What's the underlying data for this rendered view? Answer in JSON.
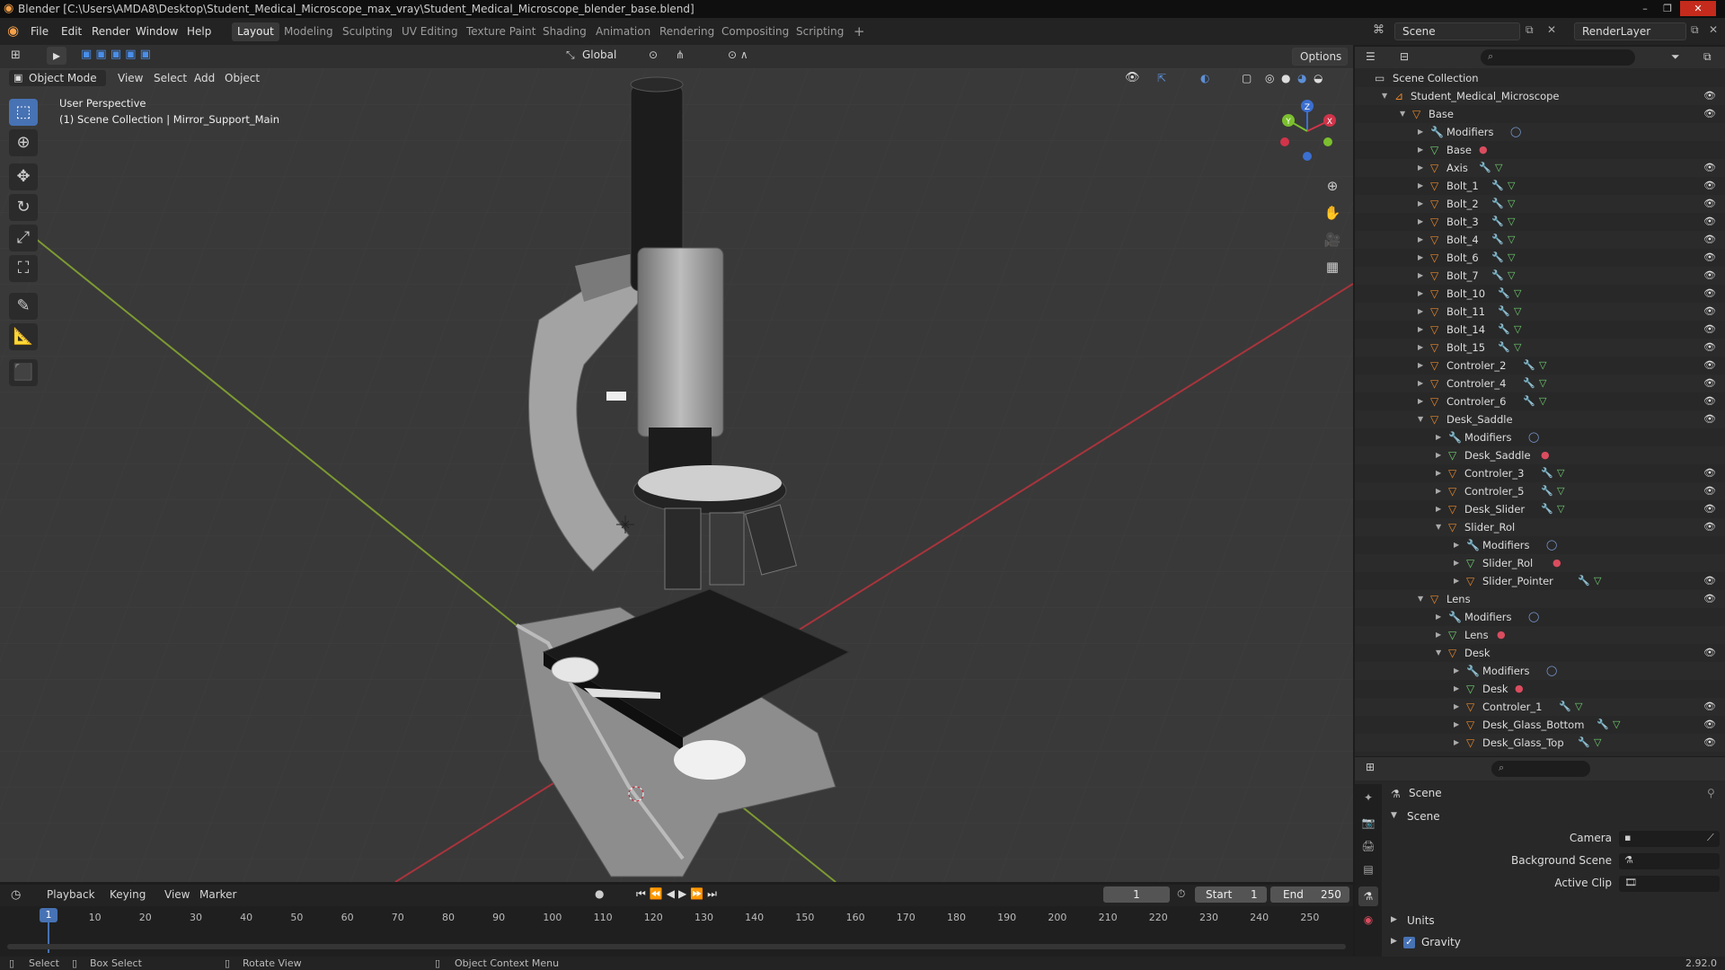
{
  "window": {
    "title": "Blender [C:\\Users\\AMDA8\\Desktop\\Student_Medical_Microscope_max_vray\\Student_Medical_Microscope_blender_base.blend]"
  },
  "menu": [
    "File",
    "Edit",
    "Render",
    "Window",
    "Help"
  ],
  "workspaces": [
    "Layout",
    "Modeling",
    "Sculpting",
    "UV Editing",
    "Texture Paint",
    "Shading",
    "Animation",
    "Rendering",
    "Compositing",
    "Scripting"
  ],
  "active_workspace": "Layout",
  "scene": {
    "name": "Scene",
    "render_layer": "RenderLayer"
  },
  "viewport": {
    "mode": "Object Mode",
    "menus": [
      "View",
      "Select",
      "Add",
      "Object"
    ],
    "transform_orientation": "Global",
    "options_label": "Options",
    "overlay_line1": "User Perspective",
    "overlay_line2": "(1) Scene Collection | Mirror_Support_Main",
    "gizmo_labels": {
      "x": "X",
      "y": "Y",
      "z": "Z"
    }
  },
  "outliner": {
    "root": "Scene Collection",
    "rows": [
      {
        "label": "Student_Medical_Microscope",
        "depth": 0,
        "expanded": true,
        "type": "collection",
        "badges": [],
        "eye": true
      },
      {
        "label": "Base",
        "depth": 1,
        "expanded": true,
        "type": "object",
        "badges": [],
        "eye": true
      },
      {
        "label": "Modifiers",
        "depth": 2,
        "expanded": false,
        "type": "modifiers",
        "badges": [
          "modifier"
        ],
        "eye": false
      },
      {
        "label": "Base",
        "depth": 2,
        "expanded": false,
        "type": "mesh",
        "badges": [
          "material"
        ],
        "eye": false
      },
      {
        "label": "Axis",
        "depth": 2,
        "expanded": false,
        "type": "object",
        "badges": [
          "wrench",
          "mesh"
        ],
        "eye": true
      },
      {
        "label": "Bolt_1",
        "depth": 2,
        "expanded": false,
        "type": "object",
        "badges": [
          "wrench",
          "mesh"
        ],
        "eye": true
      },
      {
        "label": "Bolt_2",
        "depth": 2,
        "expanded": false,
        "type": "object",
        "badges": [
          "wrench",
          "mesh"
        ],
        "eye": true
      },
      {
        "label": "Bolt_3",
        "depth": 2,
        "expanded": false,
        "type": "object",
        "badges": [
          "wrench",
          "mesh"
        ],
        "eye": true
      },
      {
        "label": "Bolt_4",
        "depth": 2,
        "expanded": false,
        "type": "object",
        "badges": [
          "wrench",
          "mesh"
        ],
        "eye": true
      },
      {
        "label": "Bolt_6",
        "depth": 2,
        "expanded": false,
        "type": "object",
        "badges": [
          "wrench",
          "mesh"
        ],
        "eye": true
      },
      {
        "label": "Bolt_7",
        "depth": 2,
        "expanded": false,
        "type": "object",
        "badges": [
          "wrench",
          "mesh"
        ],
        "eye": true
      },
      {
        "label": "Bolt_10",
        "depth": 2,
        "expanded": false,
        "type": "object",
        "badges": [
          "wrench",
          "mesh"
        ],
        "eye": true
      },
      {
        "label": "Bolt_11",
        "depth": 2,
        "expanded": false,
        "type": "object",
        "badges": [
          "wrench",
          "mesh"
        ],
        "eye": true
      },
      {
        "label": "Bolt_14",
        "depth": 2,
        "expanded": false,
        "type": "object",
        "badges": [
          "wrench",
          "mesh"
        ],
        "eye": true
      },
      {
        "label": "Bolt_15",
        "depth": 2,
        "expanded": false,
        "type": "object",
        "badges": [
          "wrench",
          "mesh"
        ],
        "eye": true
      },
      {
        "label": "Controler_2",
        "depth": 2,
        "expanded": false,
        "type": "object",
        "badges": [
          "wrench",
          "mesh"
        ],
        "eye": true
      },
      {
        "label": "Controler_4",
        "depth": 2,
        "expanded": false,
        "type": "object",
        "badges": [
          "wrench",
          "mesh"
        ],
        "eye": true
      },
      {
        "label": "Controler_6",
        "depth": 2,
        "expanded": false,
        "type": "object",
        "badges": [
          "wrench",
          "mesh"
        ],
        "eye": true
      },
      {
        "label": "Desk_Saddle",
        "depth": 2,
        "expanded": true,
        "type": "object",
        "badges": [],
        "eye": true
      },
      {
        "label": "Modifiers",
        "depth": 3,
        "expanded": false,
        "type": "modifiers",
        "badges": [
          "modifier"
        ],
        "eye": false
      },
      {
        "label": "Desk_Saddle",
        "depth": 3,
        "expanded": false,
        "type": "mesh",
        "badges": [
          "material"
        ],
        "eye": false
      },
      {
        "label": "Controler_3",
        "depth": 3,
        "expanded": false,
        "type": "object",
        "badges": [
          "wrench",
          "mesh"
        ],
        "eye": true
      },
      {
        "label": "Controler_5",
        "depth": 3,
        "expanded": false,
        "type": "object",
        "badges": [
          "wrench",
          "mesh"
        ],
        "eye": true
      },
      {
        "label": "Desk_Slider",
        "depth": 3,
        "expanded": false,
        "type": "object",
        "badges": [
          "wrench",
          "mesh"
        ],
        "eye": true
      },
      {
        "label": "Slider_Rol",
        "depth": 3,
        "expanded": true,
        "type": "object",
        "badges": [],
        "eye": true
      },
      {
        "label": "Modifiers",
        "depth": 4,
        "expanded": false,
        "type": "modifiers",
        "badges": [
          "modifier"
        ],
        "eye": false
      },
      {
        "label": "Slider_Rol",
        "depth": 4,
        "expanded": false,
        "type": "mesh",
        "badges": [
          "material"
        ],
        "eye": false
      },
      {
        "label": "Slider_Pointer",
        "depth": 4,
        "expanded": false,
        "type": "object",
        "badges": [
          "wrench",
          "mesh"
        ],
        "eye": true
      },
      {
        "label": "Lens",
        "depth": 2,
        "expanded": true,
        "type": "object",
        "badges": [],
        "eye": true
      },
      {
        "label": "Modifiers",
        "depth": 3,
        "expanded": false,
        "type": "modifiers",
        "badges": [
          "modifier"
        ],
        "eye": false
      },
      {
        "label": "Lens",
        "depth": 3,
        "expanded": false,
        "type": "mesh",
        "badges": [
          "material"
        ],
        "eye": false
      },
      {
        "label": "Desk",
        "depth": 3,
        "expanded": true,
        "type": "object",
        "badges": [],
        "eye": true
      },
      {
        "label": "Modifiers",
        "depth": 4,
        "expanded": false,
        "type": "modifiers",
        "badges": [
          "modifier"
        ],
        "eye": false
      },
      {
        "label": "Desk",
        "depth": 4,
        "expanded": false,
        "type": "mesh",
        "badges": [
          "material"
        ],
        "eye": false
      },
      {
        "label": "Controler_1",
        "depth": 4,
        "expanded": false,
        "type": "object",
        "badges": [
          "wrench",
          "mesh"
        ],
        "eye": true
      },
      {
        "label": "Desk_Glass_Bottom",
        "depth": 4,
        "expanded": false,
        "type": "object",
        "badges": [
          "wrench",
          "mesh"
        ],
        "eye": true
      },
      {
        "label": "Desk_Glass_Top",
        "depth": 4,
        "expanded": false,
        "type": "object",
        "badges": [
          "wrench",
          "mesh"
        ],
        "eye": true
      }
    ]
  },
  "properties": {
    "context": "Scene",
    "panel_title": "Scene",
    "fields": [
      {
        "label": "Camera"
      },
      {
        "label": "Background Scene"
      },
      {
        "label": "Active Clip"
      }
    ],
    "collapsed_panels": [
      {
        "label": "Units",
        "checkbox": false
      },
      {
        "label": "Gravity",
        "checkbox": true
      }
    ]
  },
  "timeline": {
    "menus": [
      "Playback",
      "Keying",
      "View",
      "Marker"
    ],
    "current_frame": "1",
    "start_label": "Start",
    "start": "1",
    "end_label": "End",
    "end": "250",
    "ticks": [
      "1",
      "10",
      "20",
      "30",
      "40",
      "50",
      "60",
      "70",
      "80",
      "90",
      "100",
      "110",
      "120",
      "130",
      "140",
      "150",
      "160",
      "170",
      "180",
      "190",
      "200",
      "210",
      "220",
      "230",
      "240",
      "250"
    ]
  },
  "status": {
    "select": "Select",
    "box_select": "Box Select",
    "rotate_view": "Rotate View",
    "context_menu": "Object Context Menu",
    "version": "2.92.0"
  },
  "colors": {
    "accent": "#4772b3",
    "object_orange": "#e8872a",
    "mesh_green": "#6fce6f",
    "modifier_blue": "#7c9dd6",
    "material_red": "#d94d5f"
  }
}
